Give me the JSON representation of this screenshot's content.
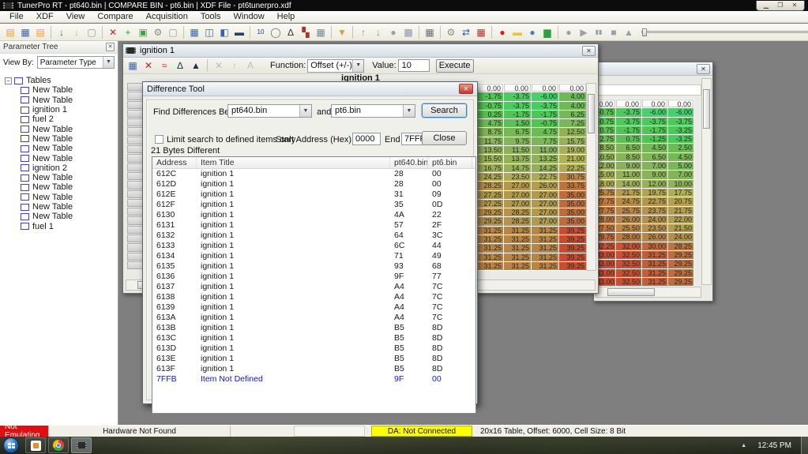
{
  "titlebar": {
    "title": "TunerPro RT - pt640.bin | COMPARE BIN - pt6.bin | XDF File - pt6tunerpro.xdf"
  },
  "menubar": {
    "items": [
      "File",
      "XDF",
      "View",
      "Compare",
      "Acquisition",
      "Tools",
      "Window",
      "Help"
    ]
  },
  "toolbar": {
    "icons": [
      {
        "n": "open-file-icon",
        "g": "▤",
        "c": "#dba43f"
      },
      {
        "n": "save-file-icon",
        "g": "▦",
        "c": "#3a62b0"
      },
      {
        "n": "open-folder-icon",
        "g": "▤",
        "c": "#dba43f"
      },
      {
        "sep": true
      },
      {
        "n": "import-icon",
        "g": "↓",
        "c": "#3a62b0"
      },
      {
        "n": "export-icon",
        "g": "↓",
        "c": "#b8b8b8"
      },
      {
        "n": "new-file-icon",
        "g": "▢",
        "c": "#9a9a9a"
      },
      {
        "sep": true
      },
      {
        "n": "delete-icon",
        "g": "✕",
        "c": "#c22222"
      },
      {
        "n": "add-item-icon",
        "g": "+",
        "c": "#2f9e44"
      },
      {
        "n": "view-item-icon",
        "g": "▣",
        "c": "#3f9e4f"
      },
      {
        "n": "wrench-icon",
        "g": "⚙",
        "c": "#8a8a8a"
      },
      {
        "n": "blank-page-icon",
        "g": "▢",
        "c": "#9a9a9a"
      },
      {
        "sep": true
      },
      {
        "n": "table-view-icon",
        "g": "▦",
        "c": "#3a62b0"
      },
      {
        "n": "split-view-icon",
        "g": "◫",
        "c": "#3a62b0"
      },
      {
        "n": "parameter-view-icon",
        "g": "◧",
        "c": "#3a62b0"
      },
      {
        "n": "monitor-icon",
        "g": "▬",
        "c": "#2c3e66"
      },
      {
        "sep": true
      },
      {
        "n": "hex-view-icon",
        "g": "10",
        "c": "#223a8c"
      },
      {
        "n": "find-icon",
        "g": "◯",
        "c": "#66707a"
      },
      {
        "n": "compare-icon",
        "g": "∆",
        "c": "#333333"
      },
      {
        "n": "tree-view-icon",
        "g": "▚",
        "c": "#b03030"
      },
      {
        "n": "calculator-icon",
        "g": "▦",
        "c": "#7a8699"
      },
      {
        "sep": true
      },
      {
        "n": "filter-icon",
        "g": "▼",
        "c": "#d9a33c"
      },
      {
        "sep": true
      },
      {
        "n": "move-up-icon",
        "g": "↑",
        "c": "#7b8ea6"
      },
      {
        "n": "move-down-icon",
        "g": "↓",
        "c": "#7b8ea6"
      },
      {
        "n": "sphere-icon",
        "g": "●",
        "c": "#9aa0a6"
      },
      {
        "n": "copy-icon",
        "g": "▩",
        "c": "#8899aa"
      },
      {
        "sep": true
      },
      {
        "n": "emulator-icon",
        "g": "▦",
        "c": "#6a6f76"
      },
      {
        "sep": true
      },
      {
        "n": "gears-icon",
        "g": "⚙",
        "c": "#8a8a8a"
      },
      {
        "n": "sync-icon",
        "g": "⇄",
        "c": "#2457c5"
      },
      {
        "n": "datalog-icon",
        "g": "▦",
        "c": "#b03030"
      },
      {
        "sep": true
      },
      {
        "n": "record-icon",
        "g": "●",
        "c": "#cc2222"
      },
      {
        "n": "notes-icon",
        "g": "▬",
        "c": "#e3c63c"
      },
      {
        "n": "world-icon",
        "g": "●",
        "c": "#3f7fbf"
      },
      {
        "n": "chart-icon",
        "g": "▆",
        "c": "#2f9e44"
      },
      {
        "sep": true
      },
      {
        "n": "da-record-icon",
        "g": "●",
        "c": "#9aa0a6"
      },
      {
        "n": "da-play-icon",
        "g": "▶",
        "c": "#9aa0a6"
      },
      {
        "n": "da-pause-icon",
        "g": "▮▮",
        "c": "#9aa0a6"
      },
      {
        "n": "da-stop-icon",
        "g": "■",
        "c": "#9aa0a6"
      },
      {
        "n": "da-eject-icon",
        "g": "▲",
        "c": "#9aa0a6"
      }
    ]
  },
  "parameter_tree": {
    "title": "Parameter Tree",
    "view_by_label": "View By:",
    "view_by_value": "Parameter Type",
    "root": "Tables",
    "items": [
      "New Table",
      "New Table",
      "ignition 1",
      "fuel 2",
      "New Table",
      "New Table",
      "New Table",
      "New Table",
      "ignition 2",
      "New Table",
      "New Table",
      "New Table",
      "New Table",
      "New Table",
      "fuel 1"
    ]
  },
  "ignition_window": {
    "title": "ignition 1",
    "toolbar_icons": [
      {
        "n": "save-table-icon",
        "g": "▦",
        "c": "#3a62b0"
      },
      {
        "n": "close-table-icon",
        "g": "✕",
        "c": "#c22222"
      },
      {
        "n": "trace-icon",
        "g": "≈",
        "c": "#c03030"
      },
      {
        "n": "compare-table-icon",
        "g": "∆",
        "c": "#223344"
      },
      {
        "n": "delta-icon",
        "g": "▲",
        "c": "#223344"
      },
      {
        "sep": true
      },
      {
        "n": "x-axis-icon",
        "g": "✕",
        "c": "#bbbbbb"
      },
      {
        "n": "y-axis-icon",
        "g": "↑",
        "c": "#bbbbbb"
      },
      {
        "n": "a-axis-icon",
        "g": "A",
        "c": "#bbbbbb"
      }
    ],
    "function_label": "Function:",
    "function_value": "Offset (+/-)",
    "value_label": "Value:",
    "value": "10",
    "execute_label": "Execute",
    "table_title": "ignition 1",
    "chart_data": {
      "type": "heatmap",
      "header": [
        "0.00",
        "0.00",
        "0.00",
        "0.00"
      ],
      "min": -6,
      "max": 39.25,
      "rows": [
        [
          -1.75,
          -3.75,
          -6.0,
          4.0
        ],
        [
          -0.75,
          -3.75,
          -3.75,
          4.0
        ],
        [
          0.25,
          -1.75,
          -1.75,
          6.25
        ],
        [
          4.75,
          1.5,
          -0.75,
          7.25
        ],
        [
          8.75,
          6.75,
          4.75,
          12.5
        ],
        [
          11.75,
          9.75,
          7.75,
          15.75
        ],
        [
          13.5,
          11.5,
          11.0,
          19.0
        ],
        [
          15.5,
          13.75,
          13.25,
          21.0
        ],
        [
          16.75,
          14.75,
          14.25,
          22.25
        ],
        [
          24.25,
          23.5,
          22.75,
          30.75
        ],
        [
          28.25,
          27.0,
          26.0,
          33.75
        ],
        [
          27.25,
          27.0,
          27.0,
          35.0
        ],
        [
          27.25,
          27.0,
          27.0,
          35.0
        ],
        [
          29.25,
          28.25,
          27.0,
          35.0
        ],
        [
          29.25,
          28.25,
          27.0,
          35.0
        ],
        [
          31.25,
          31.25,
          31.25,
          39.25
        ],
        [
          31.25,
          31.25,
          31.25,
          39.25
        ],
        [
          31.25,
          31.25,
          31.25,
          39.25
        ],
        [
          31.25,
          31.25,
          31.25,
          39.25
        ],
        [
          31.25,
          31.25,
          31.25,
          39.25
        ]
      ]
    }
  },
  "right_window": {
    "chart_data": {
      "type": "heatmap",
      "header": [
        "0.00",
        "0.00",
        "0.00",
        "0.00"
      ],
      "min": -6,
      "max": 33,
      "rows": [
        [
          -0.75,
          -3.75,
          -6.0,
          -6.0
        ],
        [
          -0.75,
          -3.75,
          -3.75,
          -3.75
        ],
        [
          0.75,
          -1.75,
          -1.75,
          -3.25
        ],
        [
          2.75,
          0.75,
          -1.25,
          -3.25
        ],
        [
          8.5,
          6.5,
          4.5,
          2.5
        ],
        [
          10.5,
          8.5,
          6.5,
          4.5
        ],
        [
          12.0,
          9.0,
          7.0,
          5.0
        ],
        [
          15.0,
          11.0,
          9.0,
          7.0
        ],
        [
          18.0,
          14.0,
          12.0,
          10.0
        ],
        [
          25.75,
          21.75,
          19.75,
          17.75
        ],
        [
          27.75,
          24.75,
          22.75,
          20.75
        ],
        [
          27.75,
          25.75,
          23.75,
          21.75
        ],
        [
          28.0,
          26.0,
          24.0,
          22.0
        ],
        [
          27.5,
          25.5,
          23.5,
          21.5
        ],
        [
          29.75,
          28.0,
          26.0,
          24.0
        ],
        [
          32.25,
          32.0,
          30.0,
          28.25
        ],
        [
          33.0,
          32.5,
          31.25,
          29.25
        ],
        [
          33.0,
          32.5,
          31.25,
          29.25
        ],
        [
          33.0,
          32.5,
          31.25,
          29.25
        ],
        [
          33.0,
          32.5,
          31.25,
          29.25
        ]
      ]
    }
  },
  "difference_tool": {
    "title": "Difference Tool",
    "find_label": "Find Differences Between",
    "file1": "pt640.bin",
    "and_label": "and",
    "file2": "pt6.bin",
    "search_label": "Search",
    "limit_label": "Limit search to defined items only",
    "start_label": "Start Address (Hex)",
    "start_value": "0000",
    "end_label": "End",
    "end_value": "7FFF",
    "close_label": "Close",
    "result_count": "21 Bytes Different",
    "columns": [
      "Address",
      "Item Title",
      "pt640.bin",
      "pt6.bin"
    ],
    "rows": [
      [
        "612C",
        "ignition 1",
        "28",
        "00"
      ],
      [
        "612D",
        "ignition 1",
        "28",
        "00"
      ],
      [
        "612E",
        "ignition 1",
        "31",
        "09"
      ],
      [
        "612F",
        "ignition 1",
        "35",
        "0D"
      ],
      [
        "6130",
        "ignition 1",
        "4A",
        "22"
      ],
      [
        "6131",
        "ignition 1",
        "57",
        "2F"
      ],
      [
        "6132",
        "ignition 1",
        "64",
        "3C"
      ],
      [
        "6133",
        "ignition 1",
        "6C",
        "44"
      ],
      [
        "6134",
        "ignition 1",
        "71",
        "49"
      ],
      [
        "6135",
        "ignition 1",
        "93",
        "68"
      ],
      [
        "6136",
        "ignition 1",
        "9F",
        "77"
      ],
      [
        "6137",
        "ignition 1",
        "A4",
        "7C"
      ],
      [
        "6138",
        "ignition 1",
        "A4",
        "7C"
      ],
      [
        "6139",
        "ignition 1",
        "A4",
        "7C"
      ],
      [
        "613A",
        "ignition 1",
        "A4",
        "7C"
      ],
      [
        "613B",
        "ignition 1",
        "B5",
        "8D"
      ],
      [
        "613C",
        "ignition 1",
        "B5",
        "8D"
      ],
      [
        "613D",
        "ignition 1",
        "B5",
        "8D"
      ],
      [
        "613E",
        "ignition 1",
        "B5",
        "8D"
      ],
      [
        "613F",
        "ignition 1",
        "B5",
        "8D"
      ],
      [
        "7FFB",
        "Item Not Defined",
        "9F",
        "00"
      ]
    ]
  },
  "status_bar": {
    "emulating": "Not Emulating",
    "hardware": "Hardware Not Found",
    "da": "DA: Not Connected",
    "table_info": "20x16 Table, Offset: 6000,  Cell Size: 8 Bit"
  },
  "taskbar": {
    "clock": "12:45 PM"
  }
}
